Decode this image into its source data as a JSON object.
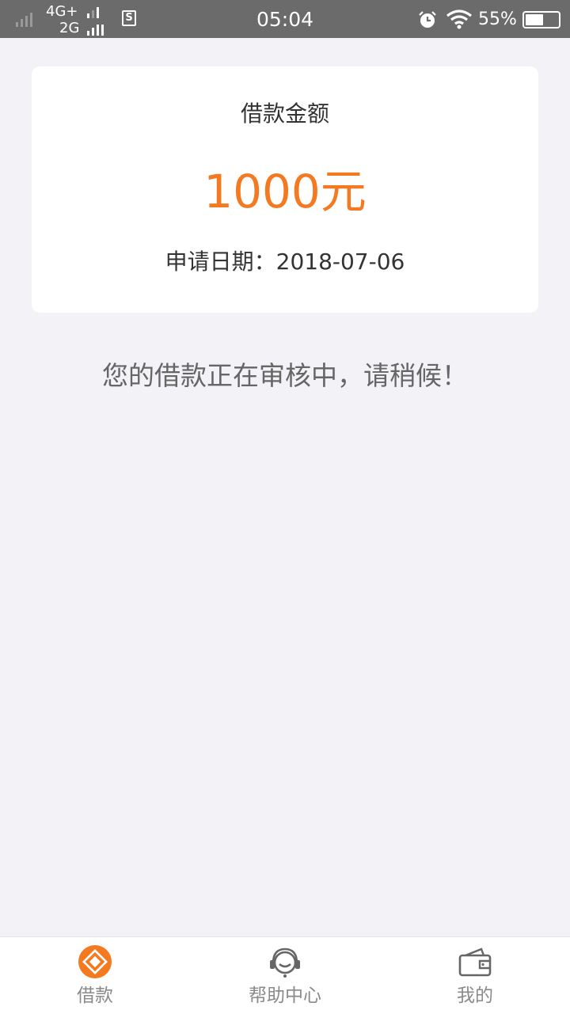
{
  "status_bar": {
    "network_line1": "4G+",
    "network_line2": "2G",
    "s_icon_label": "S",
    "time": "05:04",
    "battery_percent": "55%",
    "battery_level": 0.55
  },
  "loan_card": {
    "title": "借款金额",
    "amount": "1000元",
    "apply_date": "申请日期：2018-07-06"
  },
  "review_message": "您的借款正在审核中，请稍候！",
  "bottom_nav": {
    "items": [
      {
        "label": "借款",
        "icon": "loan-icon",
        "active": true
      },
      {
        "label": "帮助中心",
        "icon": "headset-icon",
        "active": false
      },
      {
        "label": "我的",
        "icon": "wallet-icon",
        "active": false
      }
    ]
  },
  "colors": {
    "accent": "#f37a20",
    "background": "#f2f2f7",
    "status_bar": "#6b6b6b",
    "nav_icon_gray": "#666666"
  }
}
